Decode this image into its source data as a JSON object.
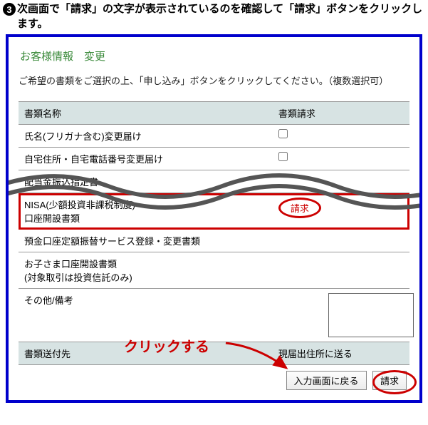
{
  "instruction": {
    "number": "3",
    "text": "次画面で「請求」の文字が表示されているのを確認して「請求」ボタンをクリックします。"
  },
  "page_title": "お客様情報　変更",
  "description": "ご希望の書類をご選択の上、「申し込み」ボタンをクリックしてください。（複数選択可）",
  "table": {
    "header_name": "書類名称",
    "header_request": "書類請求",
    "row1": "氏名(フリガナ含む)変更届け",
    "row2": "自宅住所・自宅電話番号変更届け",
    "row3": "配当金振込指定書",
    "row4_line1": "NISA(少額投資非課税制度)",
    "row4_line2": "口座開設書類",
    "row4_badge": "請求",
    "row5": "預金口座定額振替サービス登録・変更書類",
    "row6_line1": "お子さま口座開設書類",
    "row6_line2": "(対象取引は投資信託のみ)",
    "remarks_label": "その他/備考"
  },
  "destination": {
    "label": "書類送付先",
    "value": "現届出住所に送る"
  },
  "buttons": {
    "back": "入力画面に戻る",
    "submit": "請求"
  },
  "callout": "クリックする"
}
